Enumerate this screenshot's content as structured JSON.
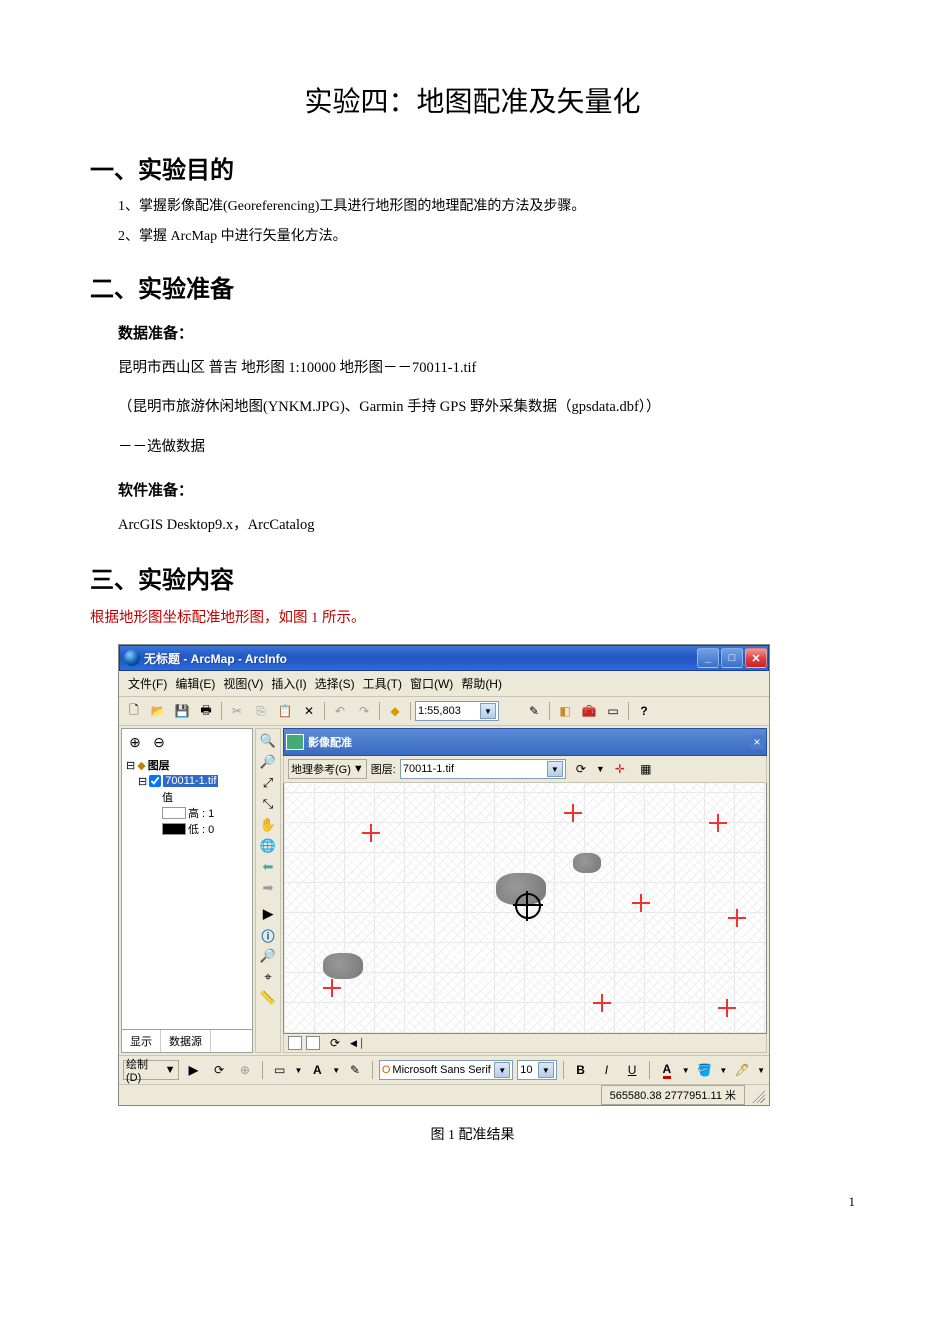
{
  "doc": {
    "title": "实验四：地图配准及矢量化",
    "h1_purpose": "一、实验目的",
    "purpose": [
      "1、掌握影像配准(Georeferencing)工具进行地形图的地理配准的方法及步骤。",
      "2、掌握 ArcMap 中进行矢量化方法。"
    ],
    "h1_prep": "二、实验准备",
    "dataprep_h": "数据准备：",
    "dataprep1": "昆明市西山区  普吉  地形图  1:10000  地形图－－70011-1.tif",
    "dataprep2": "（昆明市旅游休闲地图(YNKM.JPG)、Garmin  手持 GPS 野外采集数据（gpsdata.dbf））",
    "dataprep3": "－－选做数据",
    "swprep_h": "软件准备：",
    "swprep1": "ArcGIS  Desktop9.x，ArcCatalog",
    "h1_content": "三、实验内容",
    "content_p": "根据地形图坐标配准地形图，如图 1 所示。",
    "caption": "图 1  配准结果",
    "page_num": "1"
  },
  "app": {
    "title": "无标题 - ArcMap - ArcInfo",
    "menu": [
      "文件(F)",
      "编辑(E)",
      "视图(V)",
      "插入(I)",
      "选择(S)",
      "工具(T)",
      "窗口(W)",
      "帮助(H)"
    ],
    "scale": "1:55,803",
    "geo_toolbar_title": "影像配准",
    "geo_btn": "地理参考(G)",
    "layer_label": "图层:",
    "layer_value": "70011-1.tif",
    "toc": {
      "root": "图层",
      "item": "70011-1.tif",
      "value_lbl": "值",
      "high": "高 : 1",
      "low": "低 : 0",
      "tab1": "显示",
      "tab2": "数据源"
    },
    "draw_label": "绘制(D)",
    "font": "Microsoft Sans Serif",
    "font_size": "10",
    "coords": "565580.38  2777951.11 米"
  }
}
